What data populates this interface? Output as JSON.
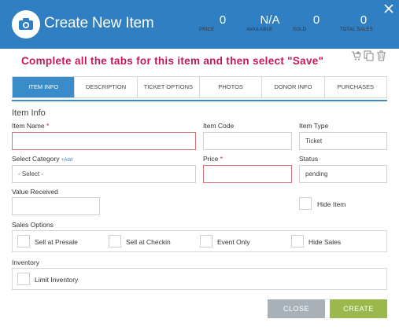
{
  "header": {
    "title": "Create New Item",
    "stats": [
      {
        "value": "0",
        "label": "PRICE"
      },
      {
        "value": "N/A",
        "label": "AVAILABLE"
      },
      {
        "value": "0",
        "label": "SOLD"
      },
      {
        "value": "0",
        "label": "TOTAL SALES"
      }
    ],
    "color": "#2f7fc2"
  },
  "banner": {
    "text": "Complete all the tabs for this item and then select \"Save\"",
    "color": "#c2185b"
  },
  "tabs": [
    {
      "label": "ITEM INFO",
      "active": true
    },
    {
      "label": "DESCRIPTION",
      "active": false
    },
    {
      "label": "TICKET OPTIONS",
      "active": false
    },
    {
      "label": "PHOTOS",
      "active": false
    },
    {
      "label": "DONOR INFO",
      "active": false
    },
    {
      "label": "PURCHASES",
      "active": false
    }
  ],
  "form": {
    "section_title": "Item Info",
    "item_name_label": "Item Name",
    "item_name_value": "",
    "item_code_label": "Item Code",
    "item_code_value": "",
    "item_type_label": "Item Type",
    "item_type_value": "Ticket",
    "select_category_label": "Select Category",
    "add_link": "+Add",
    "category_value": "- Select -",
    "price_label": "Price",
    "price_value": "",
    "status_label": "Status",
    "status_value": "pending",
    "value_received_label": "Value Received",
    "value_received_value": "",
    "hide_item_label": "Hide Item",
    "required_marker": "*",
    "sales_options_label": "Sales Options",
    "sales_options": [
      {
        "label": "Sell at Presale",
        "checked": false
      },
      {
        "label": "Sell at Checkin",
        "checked": false
      },
      {
        "label": "Event Only",
        "checked": false
      },
      {
        "label": "Hide Sales",
        "checked": false
      }
    ],
    "inventory_label": "Inventory",
    "limit_inventory_label": "Limit Inventory"
  },
  "buttons": {
    "close": "CLOSE",
    "create": "CREATE"
  },
  "icons": {
    "logo": "camera-icon",
    "close": "close-icon",
    "cart": "cart-add-icon",
    "copy": "copy-icon",
    "delete": "trash-icon"
  }
}
